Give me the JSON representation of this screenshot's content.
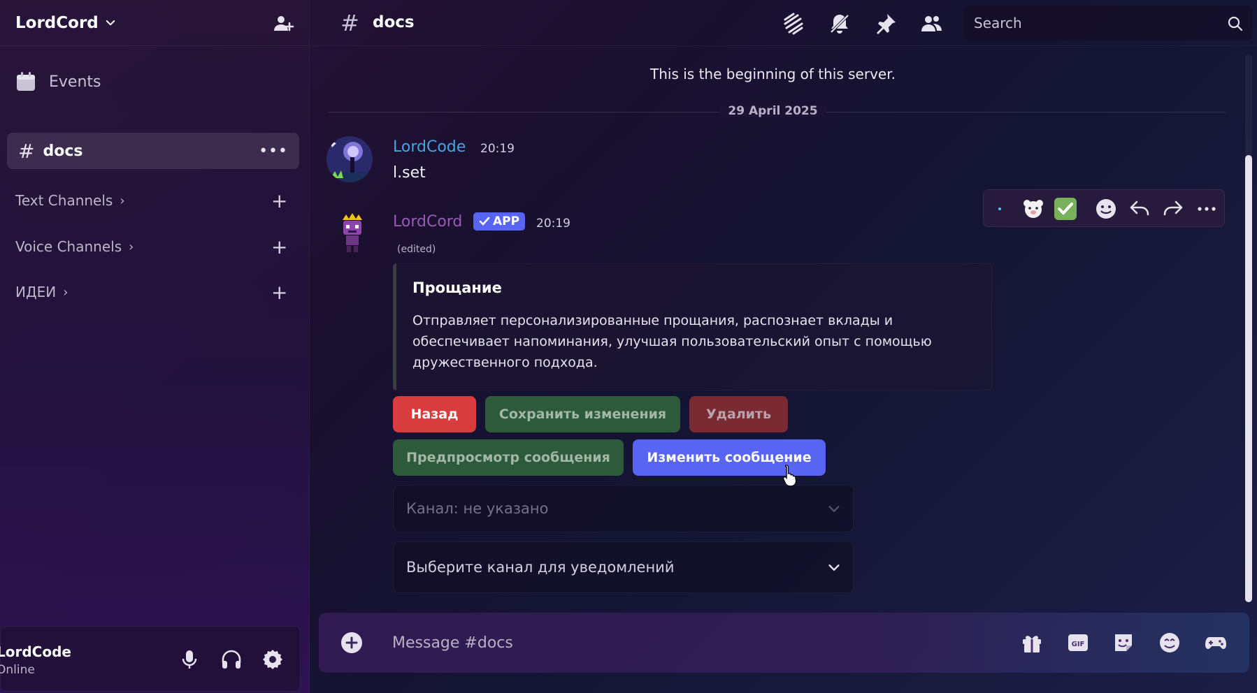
{
  "server": {
    "name": "LordCord"
  },
  "sidebar": {
    "events_label": "Events",
    "active_channel": "docs",
    "categories": [
      {
        "label": "Text Channels"
      },
      {
        "label": "Voice Channels"
      },
      {
        "label": "ИДЕИ"
      }
    ]
  },
  "user": {
    "name": "LordCode",
    "status": "Online"
  },
  "header": {
    "channel": "docs",
    "search_placeholder": "Search"
  },
  "messages": {
    "beginning": "This is the beginning of this server.",
    "date_divider": "29 April 2025",
    "first": {
      "author": "LordCode",
      "time": "20:19",
      "text": "l.set",
      "author_color": "#4aa3df"
    },
    "second": {
      "author": "LordCord",
      "badge": "APP",
      "time": "20:19",
      "edited": "(edited)",
      "author_color": "#9b59b6",
      "embed": {
        "title": "Прощание",
        "description": "Отправляет персонализированные прощания, распознает вклады и обеспечивает напоминания, улучшая пользовательский опыт с помощью дружественного подхода."
      },
      "buttons": {
        "back": "Назад",
        "save": "Сохранить изменения",
        "delete": "Удалить",
        "preview": "Предпросмотр сообщения",
        "edit": "Изменить сообщение"
      },
      "selects": {
        "channel": "Канал: не указано",
        "notify_placeholder": "Выберите канал для уведомлений"
      }
    }
  },
  "hover_bar": {
    "icons": [
      "sparkle-icon",
      "bear-emoji-icon",
      "check-emoji-icon",
      "add-reaction-icon",
      "reply-icon",
      "forward-icon",
      "more-icon"
    ]
  },
  "composer": {
    "placeholder": "Message #docs"
  },
  "colors": {
    "accent": "#5865f2",
    "danger": "#d83c3e",
    "success_dim": "#2d5a3a"
  }
}
